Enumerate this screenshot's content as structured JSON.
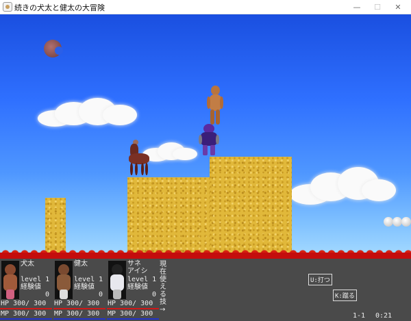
{
  "window": {
    "title": "続きの犬太と健太の大冒険",
    "minimize_glyph": "—",
    "maximize_glyph": "☐",
    "close_glyph": "✕"
  },
  "colors": {
    "sky_top": "#1a4fe0",
    "sky_bottom": "#a8dcff",
    "sand": "#e1b83a",
    "lava": "#c40d0d",
    "hud_bg": "#4a4a4a",
    "hp_bar": "#d01818",
    "mp_bar": "#2233cc"
  },
  "scene": {
    "moon_icon": "crescent-moon-icon",
    "characters": [
      "bald-man-sprite",
      "purple-robot-sprite",
      "brown-horse-sprite"
    ]
  },
  "party": [
    {
      "name": "犬太",
      "level": "level 1",
      "exp_label": "経験値",
      "exp": "0",
      "hp": "HP  300/ 300",
      "mp": "MP  300/ 300",
      "hp_fraction": 1.0,
      "mp_fraction": 1.0
    },
    {
      "name": "健太",
      "level": "level 1",
      "exp_label": "経験値",
      "exp": "0",
      "hp": "HP  300/ 300",
      "mp": "MP  300/ 300",
      "hp_fraction": 1.0,
      "mp_fraction": 1.0
    },
    {
      "name": "サネ\nアイシ",
      "name_line1": "サネ",
      "name_line2": "アイシ",
      "level": "level 1",
      "exp_label": "経験値",
      "exp": "0",
      "hp": "HP  300/ 300",
      "mp": "MP  300/ 300",
      "hp_fraction": 1.0,
      "mp_fraction": 1.0
    }
  ],
  "skills_label": "現在使える技→",
  "controls": {
    "attack": "U:打つ",
    "kick": "K:蹴る"
  },
  "stage": "1-1",
  "time": "0:21"
}
